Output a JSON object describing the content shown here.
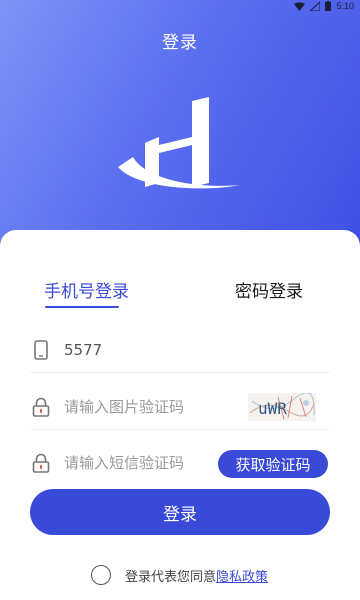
{
  "status_bar": {
    "time": "5:10"
  },
  "header": {
    "title": "登录"
  },
  "tabs": [
    {
      "label": "手机号登录",
      "active": true
    },
    {
      "label": "密码登录",
      "active": false
    }
  ],
  "form": {
    "phone": {
      "value": "5577",
      "placeholder": ""
    },
    "captcha": {
      "value": "",
      "placeholder": "请输入图片验证码",
      "image_text": "uWR"
    },
    "sms": {
      "value": "",
      "placeholder": "请输入短信验证码",
      "button_label": "获取验证码"
    }
  },
  "login_button": {
    "label": "登录"
  },
  "agreement": {
    "text": "登录代表您同意",
    "link_label": "隐私政策",
    "checked": false
  },
  "colors": {
    "accent": "#3a4ad8",
    "hero_start": "#7b93f7",
    "hero_end": "#3d4fe3"
  }
}
